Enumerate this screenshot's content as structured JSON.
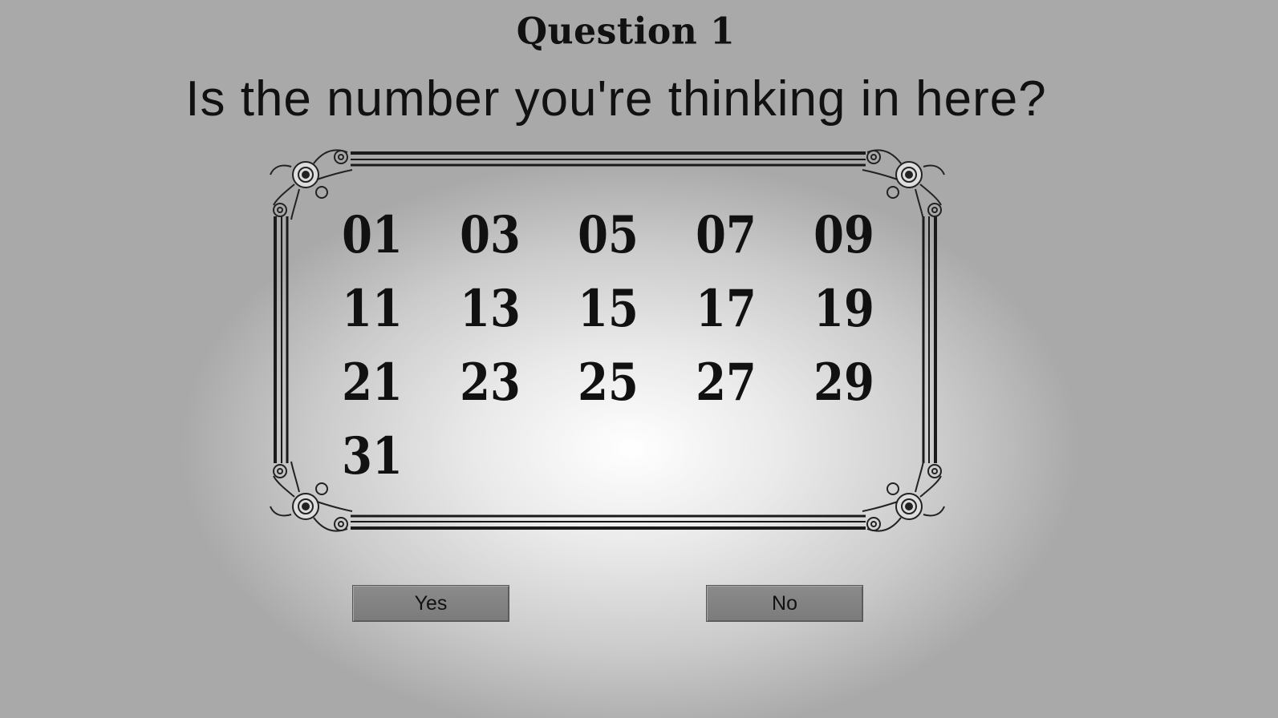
{
  "title": "Question 1",
  "question": "Is the number you're thinking in here?",
  "numbers": [
    "01",
    "03",
    "05",
    "07",
    "09",
    "11",
    "13",
    "15",
    "17",
    "19",
    "21",
    "23",
    "25",
    "27",
    "29",
    "31"
  ],
  "buttons": {
    "yes_label": "Yes",
    "no_label": "No"
  },
  "colors": {
    "button_fill": "#808080",
    "text": "#111111",
    "frame": "#1a1a1a"
  },
  "icons": {
    "frame_corner": "ornamental-scroll-icon"
  }
}
